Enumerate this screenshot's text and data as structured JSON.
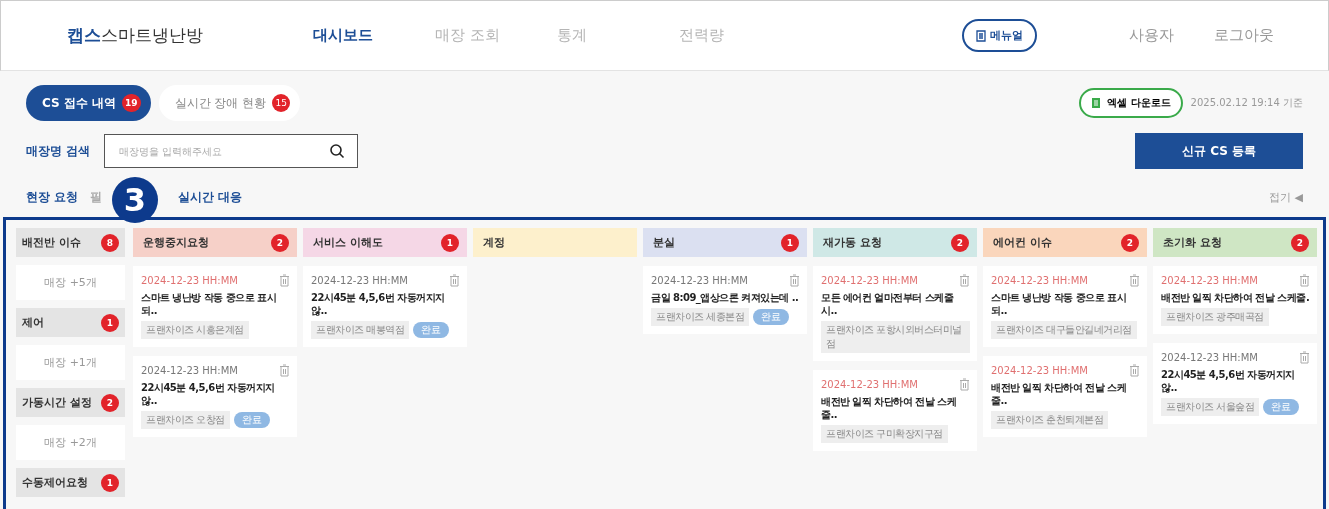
{
  "header": {
    "logo_bold": "캡스",
    "logo_rest": "스마트냉난방",
    "nav": [
      {
        "label": "대시보드",
        "selected": true
      },
      {
        "label": "매장 조회",
        "selected": false
      },
      {
        "label": "통계",
        "selected": false
      },
      {
        "label": "전력량",
        "selected": false
      }
    ],
    "manual_button": "메뉴얼",
    "user_links": [
      "사용자",
      "로그아웃"
    ]
  },
  "tabs": [
    {
      "label": "CS 접수 내역",
      "count": "19",
      "selected": true
    },
    {
      "label": "실시간 장애 현황",
      "count": "15",
      "selected": false
    }
  ],
  "excel_button": "엑셀 다운로드",
  "timestamp": "2025.02.12 19:14 기준",
  "search": {
    "label": "매장명 검색",
    "placeholder": "매장명을 입력해주세요"
  },
  "new_button": "신규 CS 등록",
  "sub_tabs": [
    {
      "label": "현장 요청",
      "selected": true
    },
    {
      "label": "필",
      "selected": false
    },
    {
      "label": "실시간 대응",
      "selected": true
    }
  ],
  "collapse": "접기 ◀",
  "marker": "3",
  "sidebar": [
    {
      "label": "배전반 이슈",
      "count": "8",
      "more": "매장 +5개"
    },
    {
      "label": "제어",
      "count": "1",
      "more": "매장 +1개"
    },
    {
      "label": "가동시간 설정",
      "count": "2",
      "more": "매장 +2개"
    },
    {
      "label": "수동제어요청",
      "count": "1"
    }
  ],
  "columns": [
    {
      "title": "운행중지요청",
      "count": "2",
      "color": "#f6d0c8",
      "cards": [
        {
          "date": "2024-12-23 HH:MM",
          "urgent": true,
          "title": "스마트 냉난방  작동 중으로 표시되..",
          "store": "프랜차이즈 시흥은계점"
        },
        {
          "date": "2024-12-23 HH:MM",
          "urgent": false,
          "title": "22시45분 4,5,6번  자동꺼지지않..",
          "store": "프랜차이즈 오창점",
          "status": "완료"
        }
      ]
    },
    {
      "title": "서비스 이해도",
      "count": "1",
      "color": "#f5d7e6",
      "cards": [
        {
          "date": "2024-12-23 HH:MM",
          "urgent": false,
          "title": "22시45분 4,5,6번  자동꺼지지않..",
          "store": "프랜차이즈 매봉역점",
          "status": "완료"
        }
      ]
    },
    {
      "title": "계정",
      "color": "#fdf0cc"
    },
    {
      "title": "분실",
      "count": "1",
      "color": "#dbe0f1",
      "cards": [
        {
          "date": "2024-12-23 HH:MM",
          "urgent": false,
          "title": "금일 8:09_앱상으론 켜져있는데 ..",
          "store": "프랜차이즈 세종본점",
          "status": "완료"
        }
      ]
    },
    {
      "title": "재가동 요청",
      "count": "2",
      "color": "#cfe8e6",
      "cards": [
        {
          "date": "2024-12-23 HH:MM",
          "urgent": true,
          "title": "모든 에어컨 얼마전부터 스케줄 시..",
          "store": "프랜차이즈 포항시외버스터미널점"
        },
        {
          "date": "2024-12-23 HH:MM",
          "urgent": true,
          "title": "배전반 일찍 차단하여 전날 스케줄..",
          "store": "프랜차이즈 구미확장지구점"
        }
      ]
    },
    {
      "title": "에어컨 이슈",
      "count": "2",
      "color": "#fad6bc",
      "cards": [
        {
          "date": "2024-12-23 HH:MM",
          "urgent": true,
          "title": "스마트 냉난방  작동 중으로 표시되..",
          "store": "프랜차이즈 대구들안길네거리점"
        },
        {
          "date": "2024-12-23 HH:MM",
          "urgent": true,
          "title": "배전반 일찍 차단하여 전날 스케줄..",
          "store": "프랜차이즈 춘천퇴계본점"
        }
      ]
    },
    {
      "title": "초기화 요청",
      "count": "2",
      "color": "#cfe6c4",
      "cards": [
        {
          "date": "2024-12-23 HH:MM",
          "urgent": true,
          "title": "배전반 일찍 차단하여 전날 스케줄.",
          "store": "프랜차이즈 광주매곡점"
        },
        {
          "date": "2024-12-23 HH:MM",
          "urgent": false,
          "title": "22시45분 4,5,6번  자동꺼지지않..",
          "store": "프랜차이즈 서울숲점",
          "status": "완료"
        }
      ]
    }
  ]
}
